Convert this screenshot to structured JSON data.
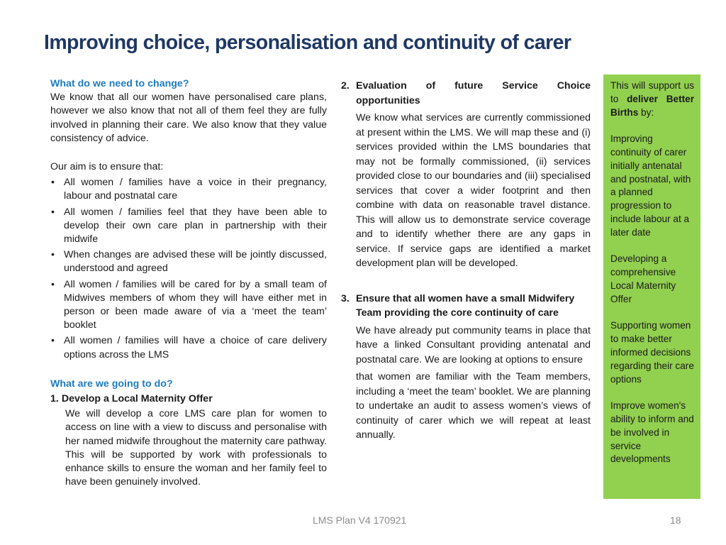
{
  "slide": {
    "title": "Improving choice, personalisation and continuity of carer",
    "footer": "LMS Plan V4 170921",
    "page_number": "18"
  },
  "left": {
    "change_heading": "What do we need to change?",
    "change_body": "We know that all our women have personalised care plans, however we also know that not all of them feel they are fully involved in planning their care. We also know that they  value consistency of advice.",
    "aim_intro": "Our aim is to ensure that:",
    "bullet_glyph": "•",
    "aims": [
      "All women / families have a voice in their pregnancy, labour and postnatal care",
      "All women / families feel that they have been able to develop their own care plan in partnership with their midwife",
      "When changes are advised these will be jointly discussed, understood and agreed",
      "All women / families will be cared for by a small team of Midwives members of whom they will have either met in person or been made aware of via a ‘meet the team’ booklet",
      "All women / families will have a choice of care delivery options across the LMS"
    ],
    "do_heading": "What are we going to do?",
    "item1": {
      "number": "1.",
      "heading": "Develop a Local Maternity Offer",
      "body": "We will develop a core LMS care plan for women to access on line with a view to discuss and personalise with her named midwife throughout the maternity care pathway. This will be supported by work with professionals to enhance skills to ensure the woman and her family feel to have been genuinely involved."
    }
  },
  "middle": {
    "item2": {
      "number": "2.",
      "heading": "Evaluation of future Service Choice opportunities",
      "body": "We know what services are currently commissioned at present within the LMS. We will map these and (i) services provided within the LMS boundaries that may not be formally commissioned, (ii) services provided close to our boundaries and (iii) specialised services that cover a wider footprint and then combine with data on  reasonable travel distance. This will allow us to demonstrate service coverage and to identify whether there are any gaps in service. If service gaps are identified a market development plan will be developed."
    },
    "item3": {
      "number": "3.",
      "heading": "Ensure that all women have a small Midwifery Team providing the core continuity of care",
      "body_1": "We have already put community teams in place that have a linked Consultant providing antenatal and postnatal care. We are looking at options to ensure",
      "body_2": "that women are familiar with the Team members, including a ‘meet the team’ booklet. We are planning to undertake an audit to assess women’s views of continuity of carer which we will repeat at least annually."
    }
  },
  "sidebar": {
    "background": "#92d050",
    "intro_prefix": "This will support us to ",
    "intro_bold": "deliver Better Births",
    "intro_suffix": " by:",
    "points": [
      "Improving continuity of carer initially antenatal and postnatal, with a planned progression to include labour at a later date",
      "Developing a comprehensive Local Maternity Offer",
      "Supporting women to make better informed decisions regarding their care options",
      "Improve women's ability to inform and be involved in service developments"
    ]
  }
}
